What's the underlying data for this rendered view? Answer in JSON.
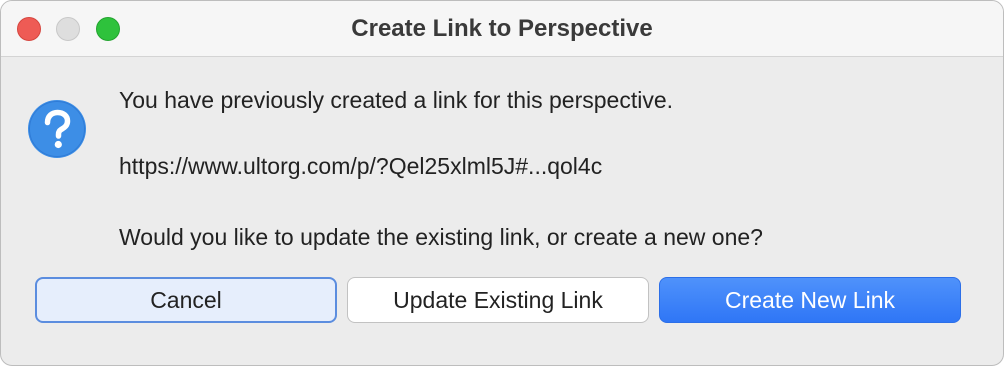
{
  "window": {
    "title": "Create Link to Perspective"
  },
  "dialog": {
    "icon": "question-icon",
    "message_line1": "You have previously created a link for this perspective.",
    "link_url": "https://www.ultorg.com/p/?Qel25xlml5J#...qol4c",
    "message_line3": "Would you like to update the existing link, or create a new one?"
  },
  "buttons": {
    "cancel_label": "Cancel",
    "update_label": "Update Existing Link",
    "create_label": "Create New Link"
  },
  "colors": {
    "accent": "#2f76f6",
    "close": "#ee5b55",
    "zoom": "#2ec23c",
    "icon_blue": "#3d8ee6"
  }
}
